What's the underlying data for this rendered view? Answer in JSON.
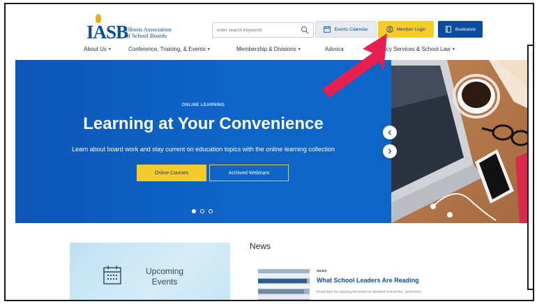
{
  "header": {
    "logo_mark": "IASB",
    "logo_name": "Illinois Association of School Boards",
    "search_placeholder": "enter search keywords",
    "events_calendar": "Events Calendar",
    "member_login": "Member Login",
    "bookstore": "Bookstore"
  },
  "nav": [
    {
      "label": "About Us"
    },
    {
      "label": "Conference, Training, & Events"
    },
    {
      "label": "Membership & Divisions"
    },
    {
      "label": "Advoca"
    },
    {
      "label": "icy Services & School Law"
    }
  ],
  "hero": {
    "eyebrow": "ONLINE LEARNING",
    "headline": "Learning at Your Convenience",
    "subline": "Learn about board work and stay current on education topics with the online learning collection",
    "primary_button": "Online Courses",
    "secondary_button": "Archived Webinars",
    "slides": 3,
    "active_slide": 1
  },
  "events_card": {
    "title_line1": "Upcoming",
    "title_line2": "Events"
  },
  "news": {
    "heading": "News",
    "items": [
      {
        "tag": "NEWS",
        "title": "What School Leaders Are Reading",
        "description": "Read tips for staying focused on student outcomes, and more"
      }
    ]
  },
  "colors": {
    "brand_blue": "#0b4d9c",
    "hero_blue": "#0f64c8",
    "accent_yellow": "#f4cb2c",
    "annotation_arrow": "#e8204f"
  }
}
